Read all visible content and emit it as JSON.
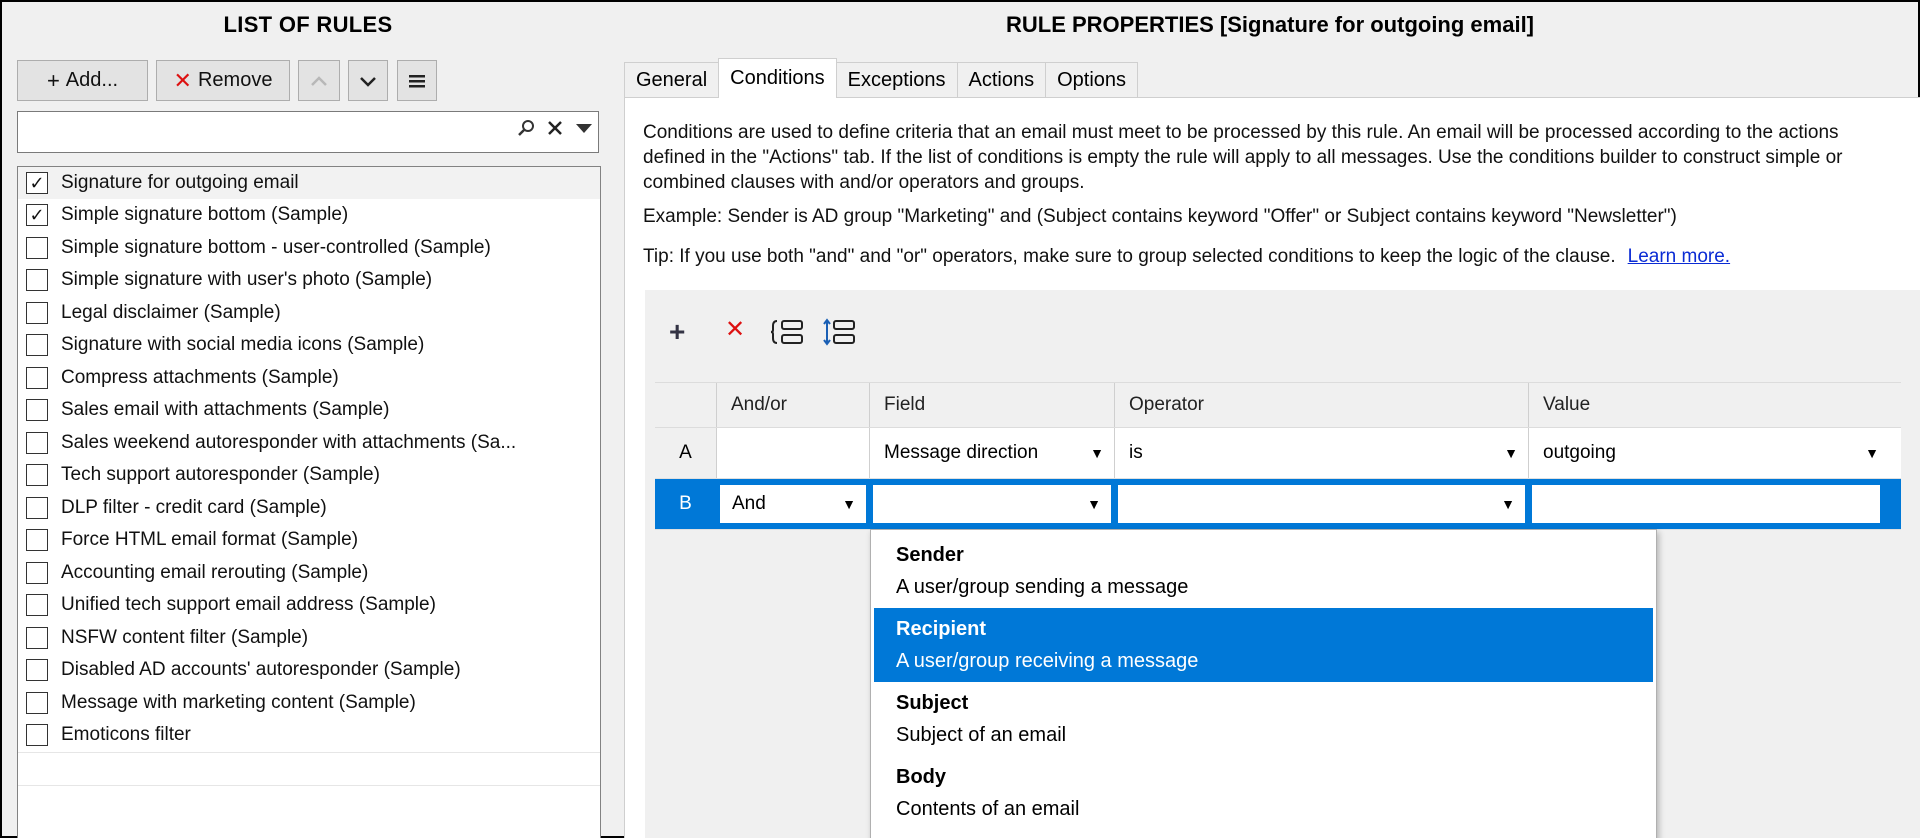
{
  "left": {
    "title": "LIST OF RULES",
    "add_label": "Add...",
    "remove_label": "Remove",
    "search_value": "",
    "rules": [
      {
        "label": "Signature for outgoing email",
        "checked": true
      },
      {
        "label": "Simple signature bottom (Sample)",
        "checked": true
      },
      {
        "label": "Simple signature bottom - user-controlled (Sample)",
        "checked": false
      },
      {
        "label": "Simple signature with user's photo (Sample)",
        "checked": false
      },
      {
        "label": "Legal disclaimer (Sample)",
        "checked": false
      },
      {
        "label": "Signature with social media icons (Sample)",
        "checked": false
      },
      {
        "label": "Compress attachments (Sample)",
        "checked": false
      },
      {
        "label": "Sales email with attachments (Sample)",
        "checked": false
      },
      {
        "label": "Sales weekend autoresponder with attachments (Sa...",
        "checked": false
      },
      {
        "label": "Tech support autoresponder (Sample)",
        "checked": false
      },
      {
        "label": "DLP filter - credit card (Sample)",
        "checked": false
      },
      {
        "label": "Force HTML email format (Sample)",
        "checked": false
      },
      {
        "label": "Accounting email rerouting (Sample)",
        "checked": false
      },
      {
        "label": "Unified tech support email address (Sample)",
        "checked": false
      },
      {
        "label": "NSFW content filter (Sample)",
        "checked": false
      },
      {
        "label": "Disabled AD accounts' autoresponder (Sample)",
        "checked": false
      },
      {
        "label": "Message with marketing content (Sample)",
        "checked": false
      },
      {
        "label": "Emoticons filter",
        "checked": false
      }
    ]
  },
  "right": {
    "title": "RULE PROPERTIES [Signature for outgoing email]",
    "tabs": [
      "General",
      "Conditions",
      "Exceptions",
      "Actions",
      "Options"
    ],
    "active_tab": "Conditions",
    "description": "Conditions are used to define criteria that an email must meet to be processed by this rule. An email will be processed according to the actions defined in the \"Actions\" tab. If the list of conditions is empty the rule will apply to all messages. Use the conditions builder to construct simple or combined clauses with and/or operators and groups.",
    "example": "Example: Sender is AD group \"Marketing\" and (Subject contains keyword \"Offer\" or Subject contains keyword \"Newsletter\")",
    "tip": "Tip: If you use both \"and\" and \"or\" operators, make sure to group selected conditions to keep the logic of the clause.",
    "learn_more": "Learn more.",
    "grid": {
      "headers": {
        "andor": "And/or",
        "field": "Field",
        "operator": "Operator",
        "value": "Value"
      },
      "rows": [
        {
          "id": "A",
          "andor": "",
          "field": "Message direction",
          "operator": "is",
          "value": "outgoing"
        },
        {
          "id": "B",
          "andor": "And",
          "field": "",
          "operator": "",
          "value": ""
        }
      ]
    },
    "field_dropdown": [
      {
        "name": "Sender",
        "desc": "A user/group sending a message",
        "highlighted": false
      },
      {
        "name": "Recipient",
        "desc": "A user/group receiving a message",
        "highlighted": true
      },
      {
        "name": "Subject",
        "desc": "Subject of an email",
        "highlighted": false
      },
      {
        "name": "Body",
        "desc": "Contents of an email",
        "highlighted": false
      }
    ]
  },
  "colors": {
    "selection": "#0078d7",
    "delete_icon": "#dd1111",
    "link": "#0a2bd4"
  }
}
